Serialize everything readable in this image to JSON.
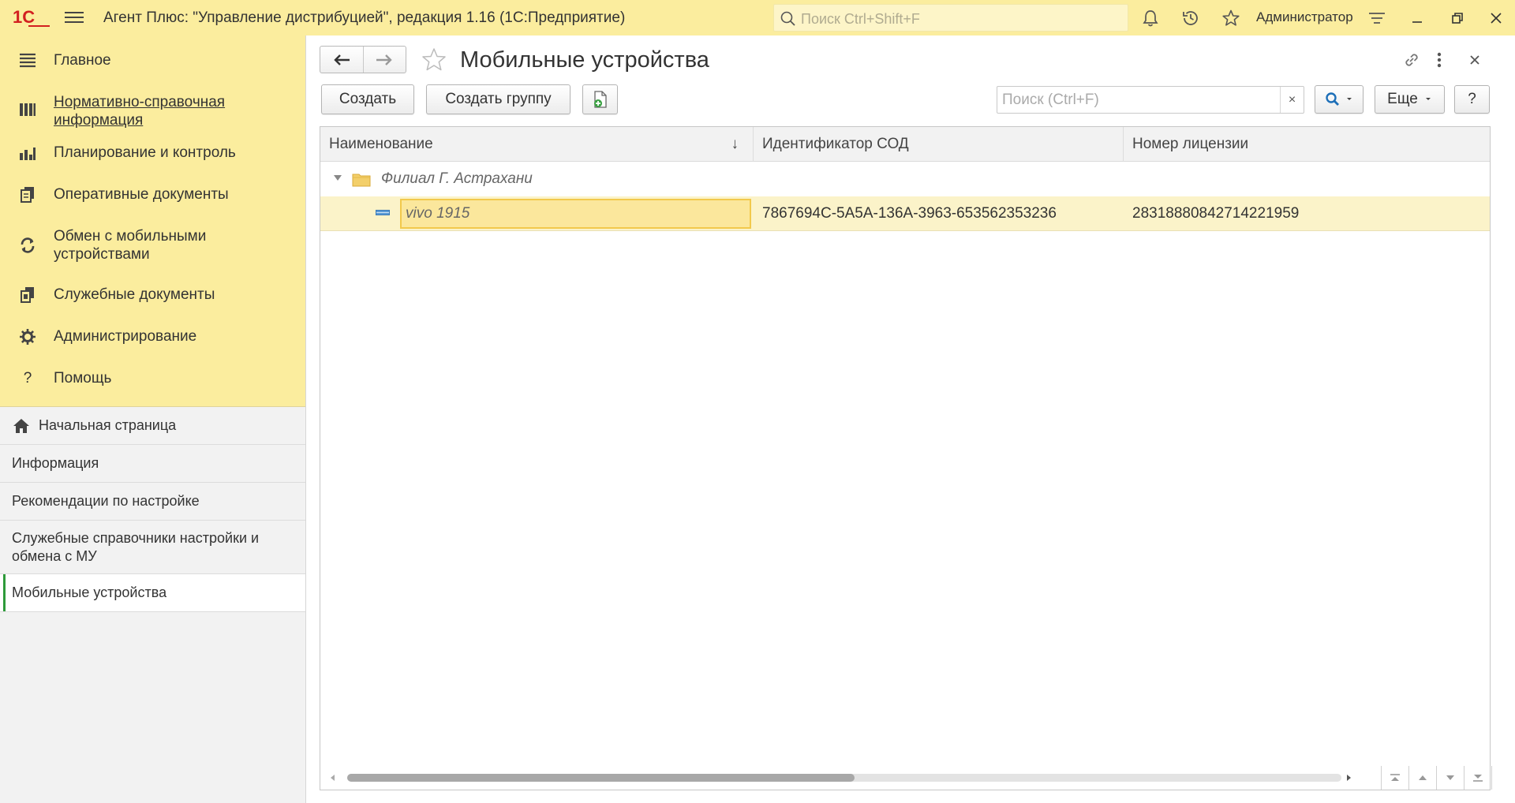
{
  "app": {
    "logo_text": "1С",
    "title": "Агент Плюс: \"Управление дистрибуцией\", редакция 1.16  (1С:Предприятие)",
    "search_placeholder": "Поиск Ctrl+Shift+F",
    "user": "Администратор",
    "brand_color": "#fbed9e",
    "logo_color": "#d22020"
  },
  "sidebar": {
    "sections": [
      {
        "label": "Главное",
        "icon": "menu-lines-icon",
        "active": false
      },
      {
        "label": "Нормативно-справочная информация",
        "icon": "book-icon",
        "active": true
      },
      {
        "label": "Планирование и контроль",
        "icon": "bar-chart-icon",
        "active": false
      },
      {
        "label": "Оперативные документы",
        "icon": "documents-icon",
        "active": false
      },
      {
        "label": "Обмен с мобильными устройствами",
        "icon": "sync-icon",
        "active": false
      },
      {
        "label": "Служебные документы",
        "icon": "service-docs-icon",
        "active": false
      },
      {
        "label": "Администрирование",
        "icon": "gear-icon",
        "active": false
      },
      {
        "label": "Помощь",
        "icon": "question-icon",
        "active": false
      }
    ],
    "nav": {
      "home": "Начальная страница",
      "items": [
        "Информация",
        "Рекомендации по настройке",
        "Служебные справочники настройки и обмена с МУ",
        "Мобильные устройства"
      ]
    }
  },
  "form": {
    "title": "Мобильные устройства",
    "create_label": "Создать",
    "create_group_label": "Создать группу",
    "search_placeholder": "Поиск (Ctrl+F)",
    "clear_symbol": "×",
    "more_label": "Еще",
    "help_label": "?"
  },
  "table": {
    "columns": [
      "Наименование",
      "Идентификатор СОД",
      "Номер лицензии"
    ],
    "sort_indicator": "↓",
    "group": {
      "name": "Филиал Г. Астрахани",
      "expanded": true
    },
    "rows": [
      {
        "name": "vivo 1915",
        "sod_id": "7867694C-5A5A-136A-3963-653562353236",
        "license": "28318880842714221959",
        "selected": true
      }
    ],
    "scroll_fraction": 0.51
  }
}
